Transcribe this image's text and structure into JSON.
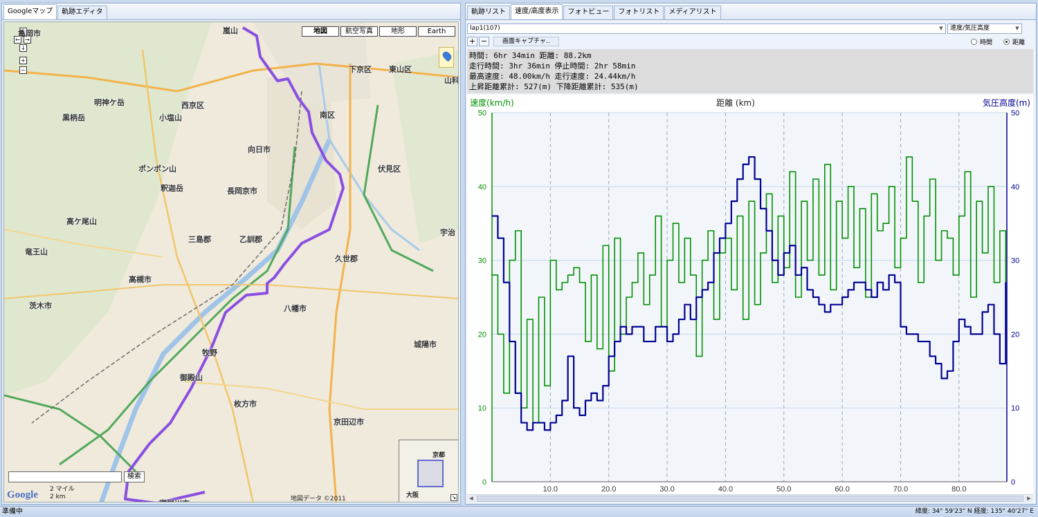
{
  "left_tabs": [
    {
      "label": "Googleマップ",
      "active": true
    },
    {
      "label": "軌跡エディタ",
      "active": false
    }
  ],
  "right_tabs": [
    {
      "label": "軌跡リスト",
      "active": false
    },
    {
      "label": "速度/高度表示",
      "active": true
    },
    {
      "label": "フォトビュー",
      "active": false
    },
    {
      "label": "フォトリスト",
      "active": false
    },
    {
      "label": "メディアリスト",
      "active": false
    }
  ],
  "map": {
    "map_types": [
      "地図",
      "航空写真",
      "地形",
      "Earth"
    ],
    "active_type": "地図",
    "labels": [
      {
        "t": "亀岡市"
      },
      {
        "t": "嵐山"
      },
      {
        "t": "西京区"
      },
      {
        "t": "下京区"
      },
      {
        "t": "東山区"
      },
      {
        "t": "南区"
      },
      {
        "t": "向日市"
      },
      {
        "t": "伏見区"
      },
      {
        "t": "長岡京市"
      },
      {
        "t": "乙訓郡"
      },
      {
        "t": "久世郡"
      },
      {
        "t": "高槻市"
      },
      {
        "t": "八幡市"
      },
      {
        "t": "城陽市"
      },
      {
        "t": "茨木市"
      },
      {
        "t": "枚方市"
      },
      {
        "t": "京田辺市"
      },
      {
        "t": "寝屋川市"
      },
      {
        "t": "三島郡"
      },
      {
        "t": "竜王山"
      },
      {
        "t": "ポンポン山"
      },
      {
        "t": "小塩山"
      },
      {
        "t": "明神ケ岳"
      },
      {
        "t": "黒柄岳"
      },
      {
        "t": "高ケ尾山"
      },
      {
        "t": "釈迦岳"
      },
      {
        "t": "牧野"
      },
      {
        "t": "御殿山"
      },
      {
        "t": "山科"
      },
      {
        "t": "宇治"
      }
    ],
    "search_button": "検索",
    "search_value": "",
    "scale": [
      "2 マイル",
      "2 km"
    ],
    "logo": "Google",
    "credit": "地図データ ©2011",
    "minimap_labels": [
      "京都",
      "大阪"
    ]
  },
  "controls": {
    "track_select": "lap1(107)",
    "mode_select": "速度/気圧高度",
    "plus": "+",
    "minus": "−",
    "capture_button": "画面キャプチャ..",
    "radio_time": "時間",
    "radio_distance": "距離",
    "selected_axis": "distance"
  },
  "stats": [
    "時間: 6hr 34min  距離: 88.2km",
    "走行時間: 3hr 36min  停止時間: 2hr 58min",
    "最高速度: 48.00km/h  走行速度: 24.44km/h",
    "上昇距離累計: 527(m)  下降距離累計: 535(m)"
  ],
  "status": {
    "text": "準備中",
    "coords": "緯度: 34° 59'23\" N  経度: 135° 40'27\" E"
  },
  "chart_data": {
    "type": "line",
    "xlabel": "距離 (km)",
    "ylabel_left": "速度(km/h)",
    "ylabel_right": "気圧高度(m)",
    "xlim": [
      0,
      88.2
    ],
    "ylim_left": [
      0,
      50
    ],
    "ylim_right": [
      0,
      50
    ],
    "x_ticks": [
      10.0,
      20.0,
      30.0,
      40.0,
      50.0,
      60.0,
      70.0,
      80.0
    ],
    "y_ticks": [
      0,
      10,
      20,
      30,
      40,
      50
    ],
    "grid": true,
    "series": [
      {
        "axis": "left",
        "color": "#009000",
        "x": [
          0,
          1,
          2,
          3,
          4,
          5,
          6,
          7,
          8,
          9,
          10,
          11,
          12,
          13,
          14,
          15,
          16,
          17,
          18,
          19,
          20,
          21,
          22,
          23,
          24,
          25,
          26,
          27,
          28,
          29,
          30,
          31,
          32,
          33,
          34,
          35,
          36,
          37,
          38,
          39,
          40,
          41,
          42,
          43,
          44,
          45,
          46,
          47,
          48,
          49,
          50,
          51,
          52,
          53,
          54,
          55,
          56,
          57,
          58,
          59,
          60,
          61,
          62,
          63,
          64,
          65,
          66,
          67,
          68,
          69,
          70,
          71,
          72,
          73,
          74,
          75,
          76,
          77,
          78,
          79,
          80,
          81,
          82,
          83,
          84,
          85,
          86,
          87,
          88
        ],
        "values": [
          28,
          20,
          12,
          30,
          34,
          10,
          22,
          8,
          25,
          13,
          30,
          26,
          27,
          28,
          29,
          27,
          19,
          28,
          18,
          32,
          15,
          33,
          20,
          25,
          27,
          31,
          24,
          28,
          36,
          21,
          30,
          35,
          27,
          33,
          28,
          17,
          30,
          34,
          22,
          31,
          33,
          26,
          36,
          22,
          38,
          24,
          31,
          39,
          27,
          36,
          29,
          42,
          25,
          38,
          30,
          41,
          28,
          43,
          26,
          38,
          33,
          40,
          29,
          37,
          25,
          39,
          34,
          35,
          40,
          29,
          33,
          44,
          38,
          27,
          36,
          41,
          30,
          34,
          33,
          28,
          36,
          42,
          25,
          38,
          31,
          40,
          27,
          34,
          22
        ]
      },
      {
        "axis": "right",
        "color": "#000090",
        "x": [
          0,
          1,
          2,
          3,
          4,
          5,
          6,
          7,
          8,
          9,
          10,
          11,
          12,
          13,
          14,
          15,
          16,
          17,
          18,
          19,
          20,
          21,
          22,
          23,
          24,
          25,
          26,
          27,
          28,
          29,
          30,
          31,
          32,
          33,
          34,
          35,
          36,
          37,
          38,
          39,
          40,
          41,
          42,
          43,
          44,
          45,
          46,
          47,
          48,
          49,
          50,
          51,
          52,
          53,
          54,
          55,
          56,
          57,
          58,
          59,
          60,
          61,
          62,
          63,
          64,
          65,
          66,
          67,
          68,
          69,
          70,
          71,
          72,
          73,
          74,
          75,
          76,
          77,
          78,
          79,
          80,
          81,
          82,
          83,
          84,
          85,
          86,
          87,
          88
        ],
        "values": [
          36,
          33,
          27,
          19,
          12,
          8,
          7,
          8,
          8,
          7,
          8,
          9,
          11,
          17,
          10,
          9,
          11,
          12,
          11,
          13,
          17,
          19,
          21,
          20,
          21,
          21,
          19,
          19,
          21,
          21,
          19,
          20,
          22,
          24,
          22,
          25,
          26,
          27,
          31,
          33,
          35,
          38,
          41,
          43,
          44,
          41,
          37,
          34,
          30,
          28,
          31,
          32,
          28,
          29,
          26,
          25,
          24,
          23,
          24,
          24,
          25,
          26,
          27,
          27,
          26,
          25,
          27,
          26,
          28,
          27,
          21,
          20,
          20,
          19,
          19,
          17,
          16,
          14,
          15,
          19,
          22,
          21,
          20,
          20,
          23,
          24,
          20,
          16,
          27
        ]
      }
    ]
  }
}
